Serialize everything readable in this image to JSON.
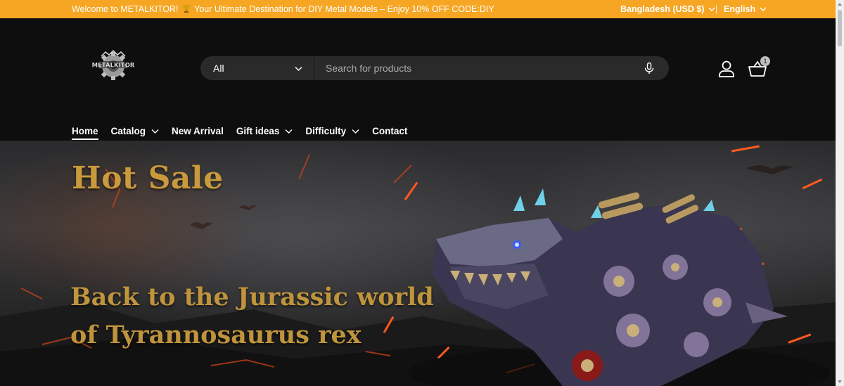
{
  "announcement": {
    "message_before": "Welcome to METALKITOR! ",
    "message_after": " Your Ultimate Destination for DIY Metal Models – Enjoy 10% OFF CODE:DIY",
    "trophy_icon": "trophy-icon",
    "country": "Bangladesh (USD $)",
    "separator": "|",
    "language": "English"
  },
  "header": {
    "logo_text": "METALKITOR",
    "search": {
      "category": "All",
      "placeholder": "Search for products"
    },
    "cart_count": "1"
  },
  "nav": {
    "items": [
      {
        "label": "Home"
      },
      {
        "label": "Catalog"
      },
      {
        "label": "New Arrival"
      },
      {
        "label": "Gift ideas"
      },
      {
        "label": "Difficulty"
      },
      {
        "label": "Contact"
      }
    ]
  },
  "hero": {
    "title": "Hot Sale",
    "subtitle_line1": "Back to the Jurassic world",
    "subtitle_line2": "of Tyrannosaurus rex"
  },
  "colors": {
    "announcement_bg": "#f6a623",
    "header_bg": "#0e0e0e",
    "search_bg": "#2a2a2a",
    "hero_text": "#c99a3c"
  }
}
